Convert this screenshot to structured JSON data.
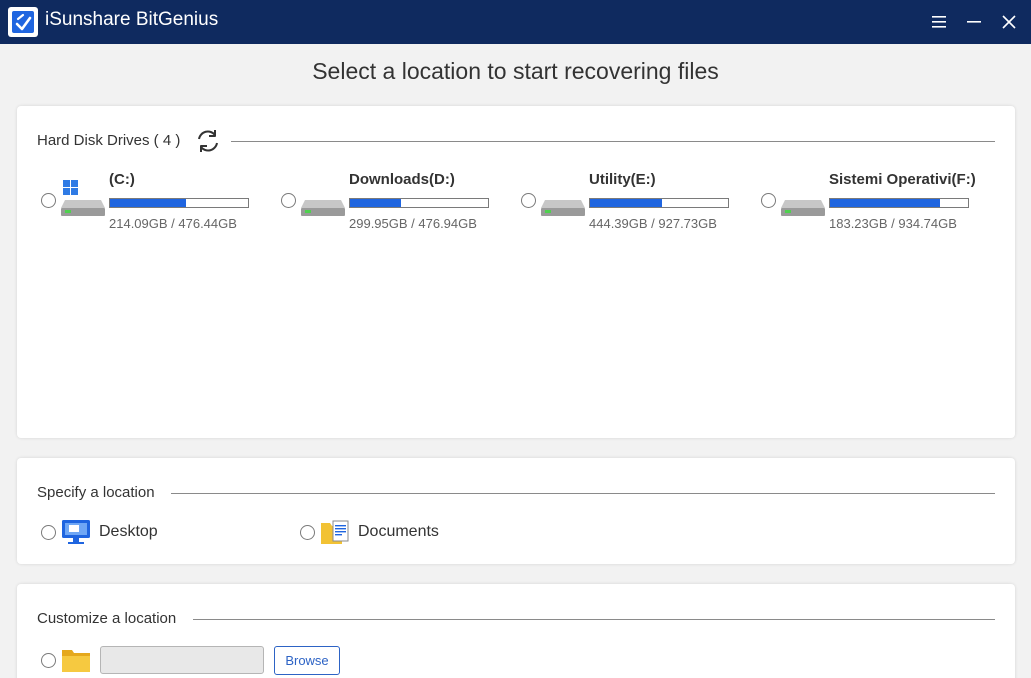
{
  "window": {
    "title": "iSunshare BitGenius",
    "accent_color": "#0f2a5f",
    "controls": [
      "menu-icon",
      "minimize-icon",
      "close-icon"
    ]
  },
  "heading": "Select a location to start recovering files",
  "hard_disks": {
    "title": "Hard Disk Drives ( 4 )",
    "refresh_icon": "refresh-icon",
    "bar_color": "#1f65e0",
    "drives": [
      {
        "name": "(C:)",
        "size": "214.09GB / 476.44GB",
        "used_fraction": 0.55,
        "icon": "windows-drive-icon"
      },
      {
        "name": "Downloads(D:)",
        "size": "299.95GB / 476.94GB",
        "used_fraction": 0.37,
        "icon": "hard-drive-icon"
      },
      {
        "name": "Utility(E:)",
        "size": "444.39GB / 927.73GB",
        "used_fraction": 0.52,
        "icon": "hard-drive-icon"
      },
      {
        "name": "Sistemi Operativi(F:)",
        "size": "183.23GB / 934.74GB",
        "used_fraction": 0.8,
        "icon": "hard-drive-icon"
      }
    ]
  },
  "specify": {
    "title": "Specify a location",
    "items": [
      {
        "label": "Desktop",
        "icon": "desktop-icon"
      },
      {
        "label": "Documents",
        "icon": "documents-folder-icon"
      }
    ]
  },
  "customize": {
    "title": "Customize a location",
    "path_value": "",
    "browse_label": "Browse",
    "icon": "folder-icon"
  }
}
